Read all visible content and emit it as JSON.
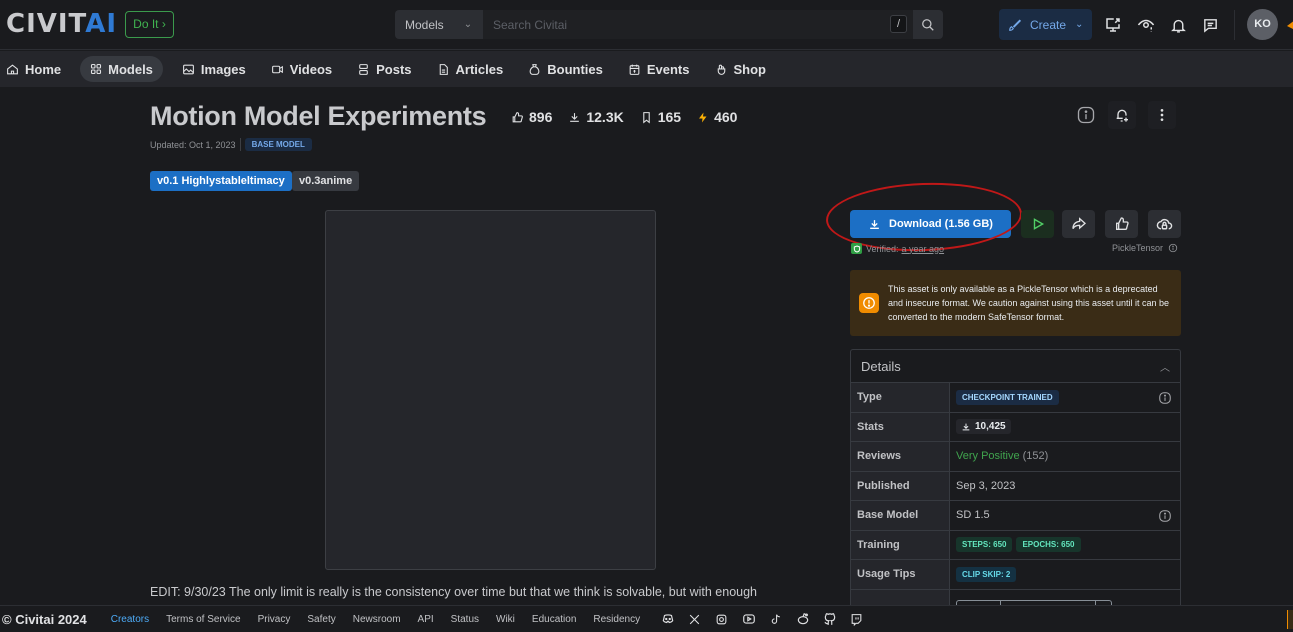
{
  "header": {
    "logo_main": "CIVIT",
    "logo_accent": "AI",
    "promo_label": "Do It",
    "search": {
      "scope": "Models",
      "placeholder": "Search Civitai",
      "shortcut": "/"
    },
    "create_label": "Create",
    "avatar_initials": "KO"
  },
  "nav": {
    "items": [
      {
        "label": "Home",
        "icon": "home-icon"
      },
      {
        "label": "Models",
        "icon": "grid-icon",
        "active": true
      },
      {
        "label": "Images",
        "icon": "image-icon"
      },
      {
        "label": "Videos",
        "icon": "video-icon"
      },
      {
        "label": "Posts",
        "icon": "posts-icon"
      },
      {
        "label": "Articles",
        "icon": "article-icon"
      },
      {
        "label": "Bounties",
        "icon": "bounty-icon"
      },
      {
        "label": "Events",
        "icon": "calendar-icon"
      },
      {
        "label": "Shop",
        "icon": "shop-icon"
      }
    ]
  },
  "model": {
    "title": "Motion Model Experiments",
    "stats": {
      "likes": "896",
      "downloads": "12.3K",
      "bookmarks": "165",
      "buzz": "460"
    },
    "updated": "Updated: Oct 1, 2023",
    "badge": "BASE MODEL",
    "versions": [
      "v0.1 Highlystableltimacy",
      "v0.3anime"
    ],
    "description": "EDIT: 9/30/23 The only limit is really is the consistency over time but that we think is solvable, but with enough"
  },
  "sidebar": {
    "download_label": "Download (1.56 GB)",
    "verified_label": "Verified:",
    "verified_time": "a year ago",
    "format": "PickleTensor",
    "warning": "This asset is only available as a PickleTensor which is a deprecated and insecure format. We caution against using this asset until it can be converted to the modern SafeTensor format.",
    "details": {
      "title": "Details",
      "rows": {
        "type": {
          "label": "Type",
          "value": "CHECKPOINT TRAINED"
        },
        "stats": {
          "label": "Stats",
          "value": "10,425"
        },
        "reviews": {
          "label": "Reviews",
          "value": "Very Positive",
          "count": "(152)"
        },
        "published": {
          "label": "Published",
          "value": "Sep 3, 2023"
        },
        "base_model": {
          "label": "Base Model",
          "value": "SD 1.5"
        },
        "training": {
          "label": "Training",
          "steps": "STEPS: 650",
          "epochs": "EPOCHS: 650"
        },
        "usage_tips": {
          "label": "Usage Tips",
          "value": "CLIP SKIP: 2"
        }
      }
    }
  },
  "footer": {
    "copyright": "© Civitai 2024",
    "links": [
      "Creators",
      "Terms of Service",
      "Privacy",
      "Safety",
      "Newsroom",
      "API",
      "Status",
      "Wiki",
      "Education",
      "Residency"
    ],
    "social": [
      "discord-icon",
      "x-icon",
      "instagram-icon",
      "youtube-icon",
      "tiktok-icon",
      "reddit-icon",
      "github-icon",
      "twitch-icon"
    ]
  }
}
